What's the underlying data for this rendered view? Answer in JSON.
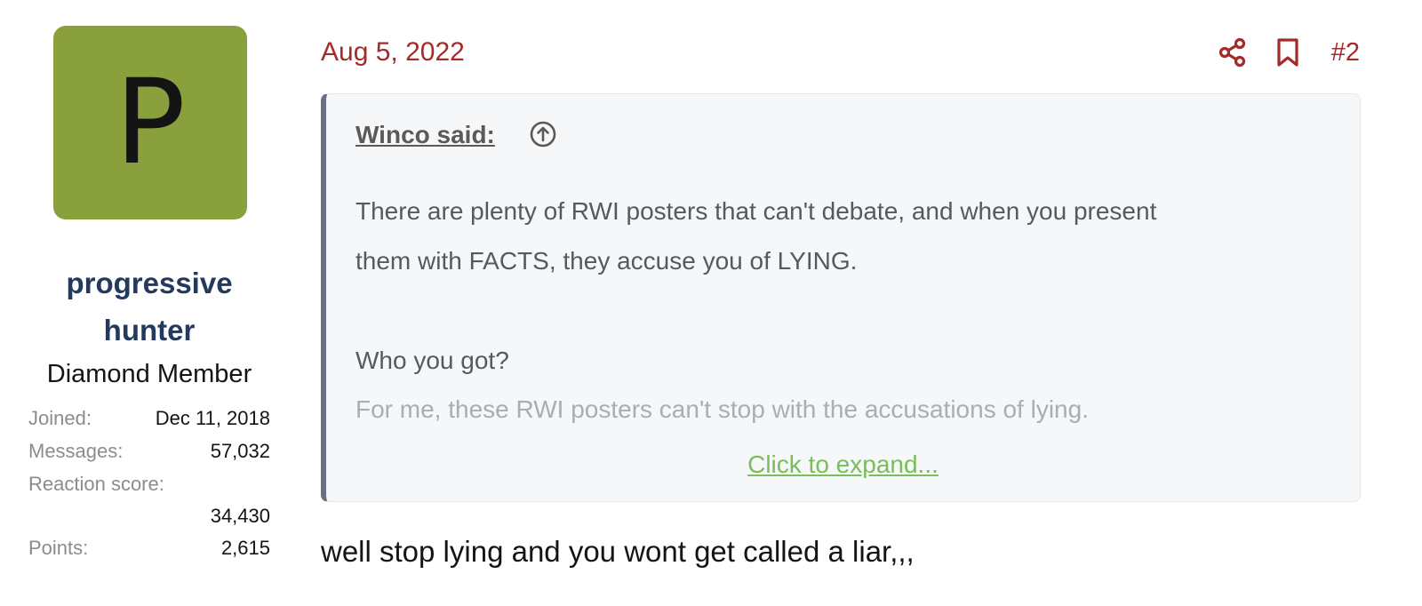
{
  "user": {
    "avatar_letter": "P",
    "avatar_color": "#8aa03c",
    "name_line1": "progressive",
    "name_line2": "hunter",
    "title": "Diamond Member",
    "stats": {
      "joined_label": "Joined:",
      "joined_value": "Dec 11, 2018",
      "messages_label": "Messages:",
      "messages_value": "57,032",
      "reaction_label": "Reaction score:",
      "reaction_value": "34,430",
      "points_label": "Points:",
      "points_value": "2,615"
    }
  },
  "post": {
    "date": "Aug 5, 2022",
    "number": "#2",
    "icons": {
      "share": "share-icon",
      "bookmark": "bookmark-icon"
    },
    "accent_color": "#a52a2a",
    "quote": {
      "author": "Winco said:",
      "jump_icon": "arrow-up-circle-icon",
      "line1": "There are plenty of RWI posters that can't debate, and when you present",
      "line2": "them with FACTS, they accuse you of LYING.",
      "line3": "Who you got?",
      "line4": "For me, these RWI posters can't stop with the accusations of lying.",
      "expand_label": "Click to expand..."
    },
    "body": "well stop lying and you wont get called a liar,,,"
  }
}
